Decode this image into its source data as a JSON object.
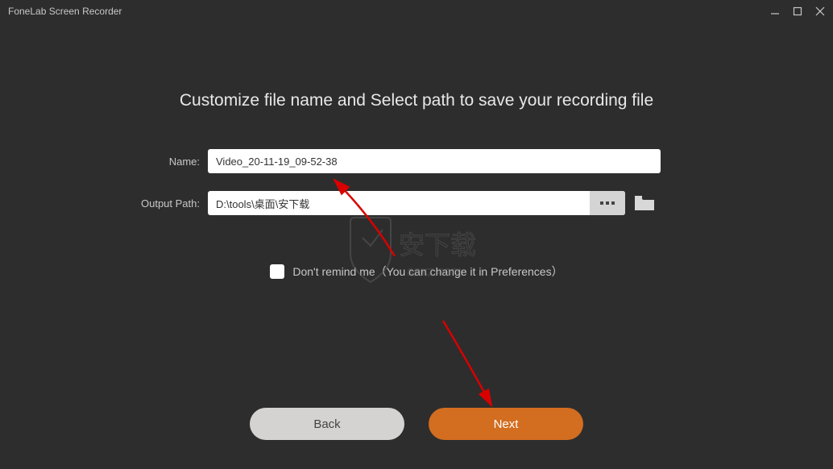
{
  "titlebar": {
    "title": "FoneLab Screen Recorder"
  },
  "heading": "Customize file name and Select path to save your recording file",
  "form": {
    "name_label": "Name:",
    "name_value": "Video_20-11-19_09-52-38",
    "path_label": "Output Path:",
    "path_value": "D:\\tools\\桌面\\安下载"
  },
  "remind": {
    "text": "Don't remind me（You can change it in Preferences）"
  },
  "buttons": {
    "back": "Back",
    "next": "Next"
  }
}
